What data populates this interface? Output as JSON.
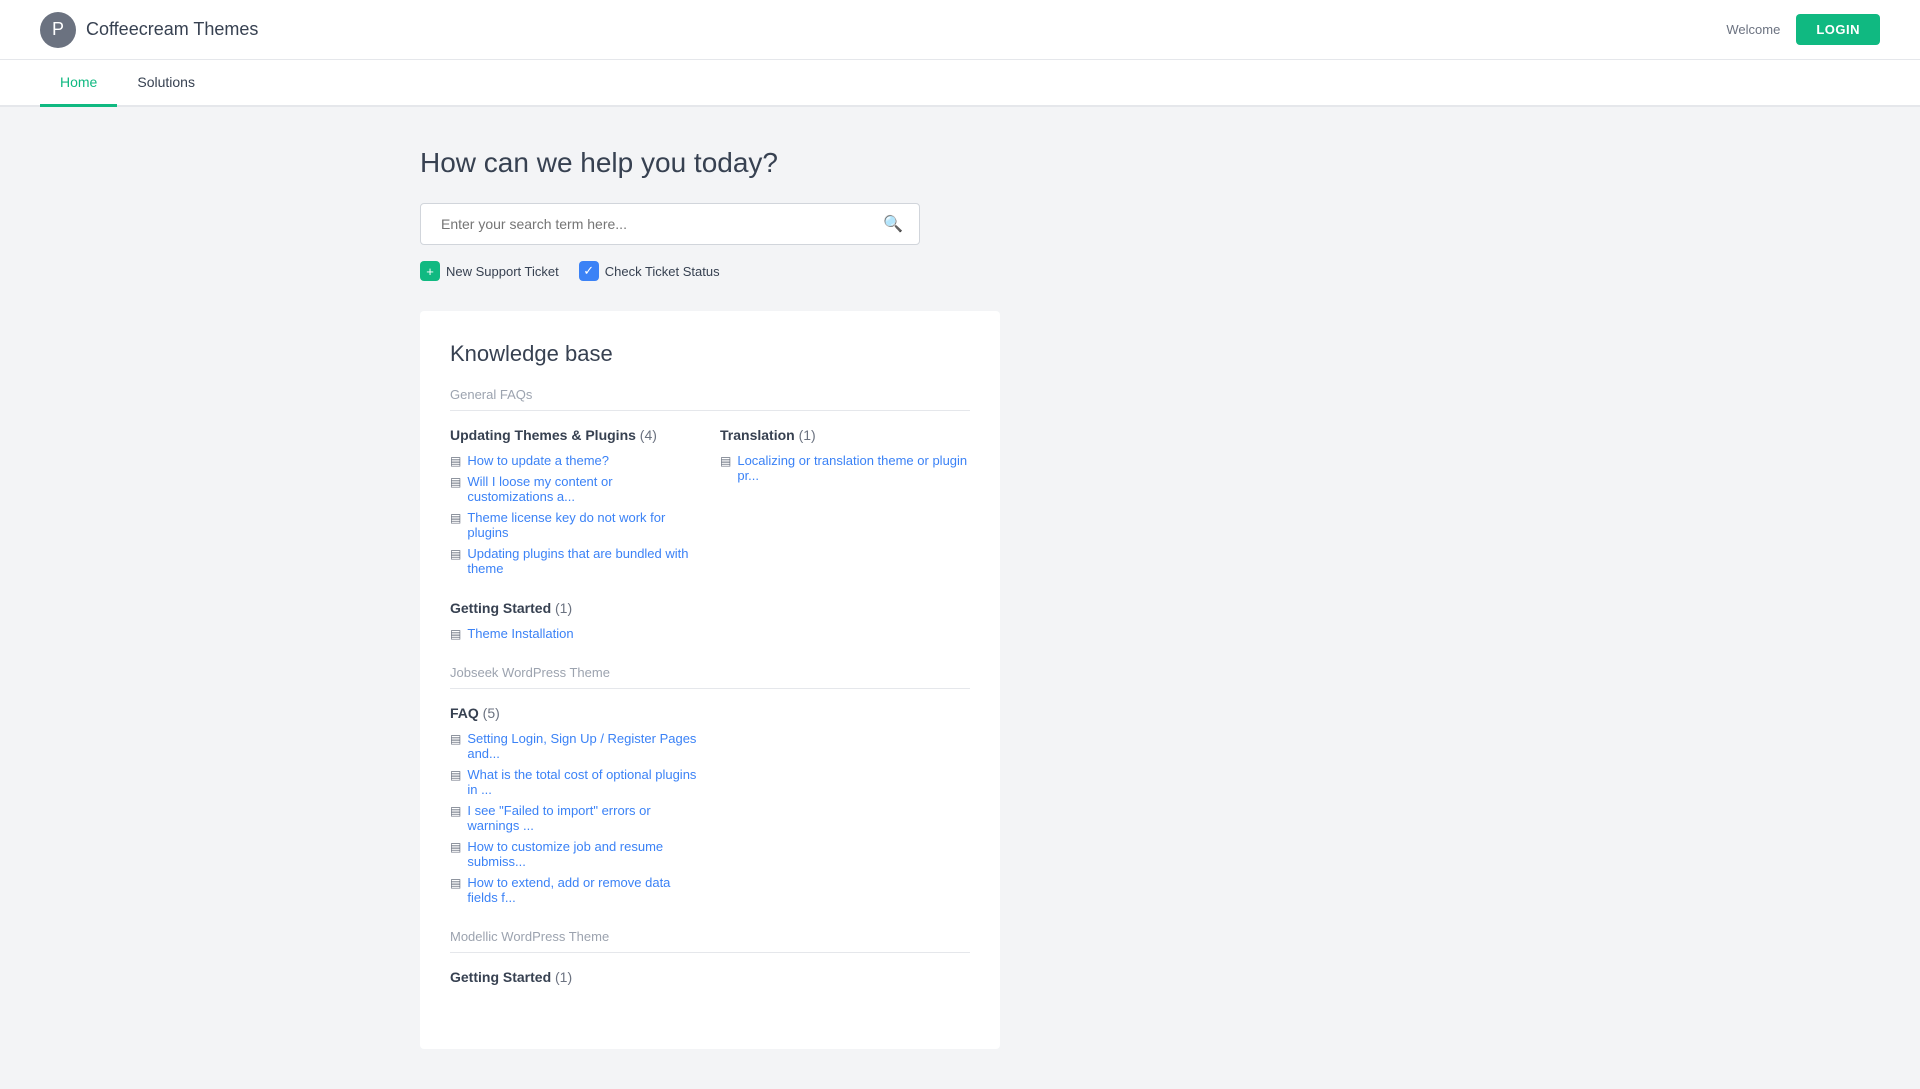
{
  "header": {
    "brand_logo_char": "P",
    "brand_name": "Coffeecream Themes",
    "welcome_text": "Welcome",
    "login_label": "LOGIN"
  },
  "nav": {
    "items": [
      {
        "label": "Home",
        "active": true
      },
      {
        "label": "Solutions",
        "active": false
      }
    ]
  },
  "hero": {
    "title": "How can we help you today?",
    "search_placeholder": "Enter your search term here..."
  },
  "actions": [
    {
      "label": "New Support Ticket",
      "icon_type": "green",
      "icon_char": "+"
    },
    {
      "label": "Check Ticket Status",
      "icon_type": "blue",
      "icon_char": "✓"
    }
  ],
  "knowledge_base": {
    "title": "Knowledge base",
    "sections": [
      {
        "group_title": "General FAQs",
        "categories": [
          {
            "title": "Updating Themes & Plugins",
            "count": "(4)",
            "articles": [
              "How to update a theme?",
              "Will I loose my content or customizations a...",
              "Theme license key do not work for plugins",
              "Updating plugins that are bundled with theme"
            ]
          },
          {
            "title": "Translation",
            "count": "(1)",
            "articles": [
              "Localizing or translation theme or plugin pr..."
            ]
          }
        ]
      },
      {
        "group_title": "",
        "categories": [
          {
            "title": "Getting Started",
            "count": "(1)",
            "articles": [
              "Theme Installation"
            ]
          }
        ]
      },
      {
        "group_title": "Jobseek WordPress Theme",
        "categories": [
          {
            "title": "FAQ",
            "count": "(5)",
            "articles": [
              "Setting Login, Sign Up / Register Pages and...",
              "What is the total cost of optional plugins in ...",
              "I see \"Failed to import\" errors or warnings ...",
              "How to customize job and resume submiss...",
              "How to extend, add or remove data fields f..."
            ]
          }
        ]
      },
      {
        "group_title": "Modellic WordPress Theme",
        "categories": [
          {
            "title": "Getting Started",
            "count": "(1)",
            "articles": []
          }
        ]
      }
    ]
  }
}
